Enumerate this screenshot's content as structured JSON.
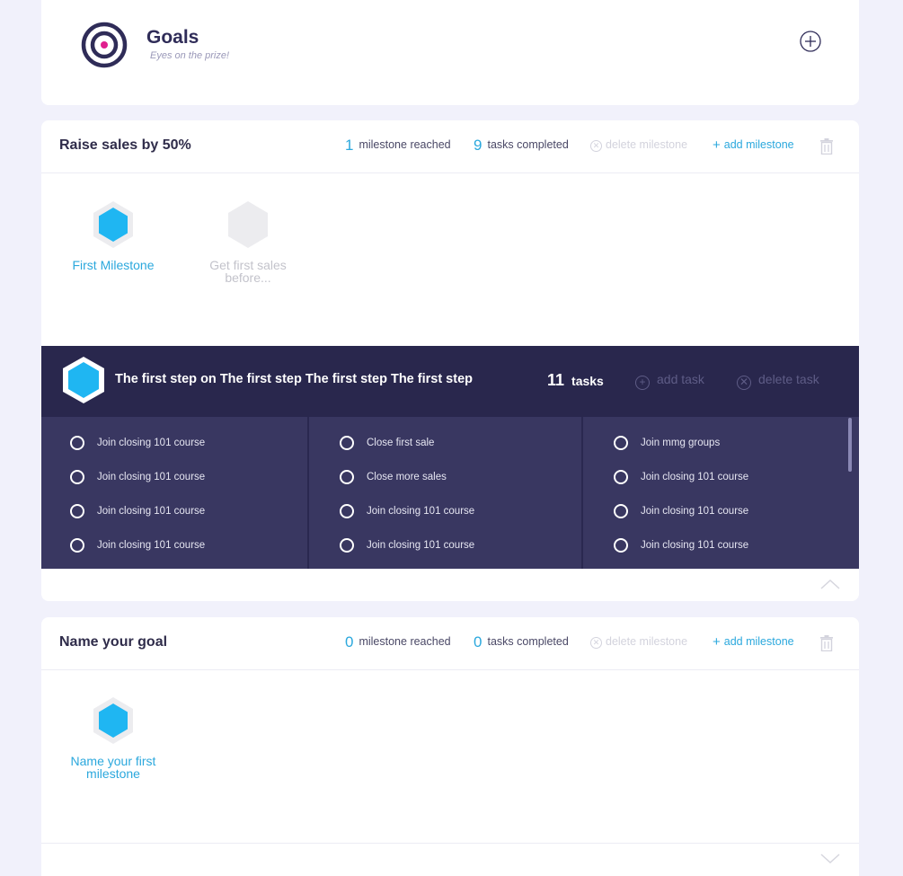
{
  "header": {
    "title": "Goals",
    "subtitle": "Eyes on the prize!",
    "icons": {
      "logo": "target-icon",
      "add": "plus-circle-icon"
    }
  },
  "goals": [
    {
      "title": "Raise sales by 50%",
      "milestones_reached": "1",
      "milestones_label": "milestone reached",
      "tasks_completed": "9",
      "tasks_label": "tasks completed",
      "delete_milestone": "delete milestone",
      "add_milestone": "add milestone",
      "milestones": [
        {
          "label": "First Milestone",
          "active": true
        },
        {
          "label": "Get first sales before...",
          "active": false
        }
      ],
      "step": {
        "title": "The first step on The first step The first step The first step",
        "task_count": "11",
        "task_count_label": "tasks",
        "add_task": "add task",
        "delete_task": "delete task",
        "columns": [
          [
            "Join closing 101 course",
            "Join closing 101 course",
            "Join closing 101 course",
            "Join closing 101 course"
          ],
          [
            "Close first sale",
            "Close more sales",
            "Join closing 101 course",
            "Join closing 101 course"
          ],
          [
            "Join mmg groups",
            "Join closing 101 course",
            "Join closing 101 course",
            "Join closing 101 course"
          ]
        ]
      }
    },
    {
      "title": "Name your goal",
      "milestones_reached": "0",
      "milestones_label": "milestone reached",
      "tasks_completed": "0",
      "tasks_label": "tasks completed",
      "delete_milestone": "delete milestone",
      "add_milestone": "add milestone",
      "milestones": [
        {
          "label": "Name your first milestone",
          "active": true
        }
      ]
    }
  ],
  "colors": {
    "accent": "#2ba8dd",
    "hex_active": "#1fb6f2",
    "hex_inactive": "#ececef",
    "step_header": "#29274d",
    "step_body": "#393761",
    "page_bg": "#f1f1fb"
  }
}
